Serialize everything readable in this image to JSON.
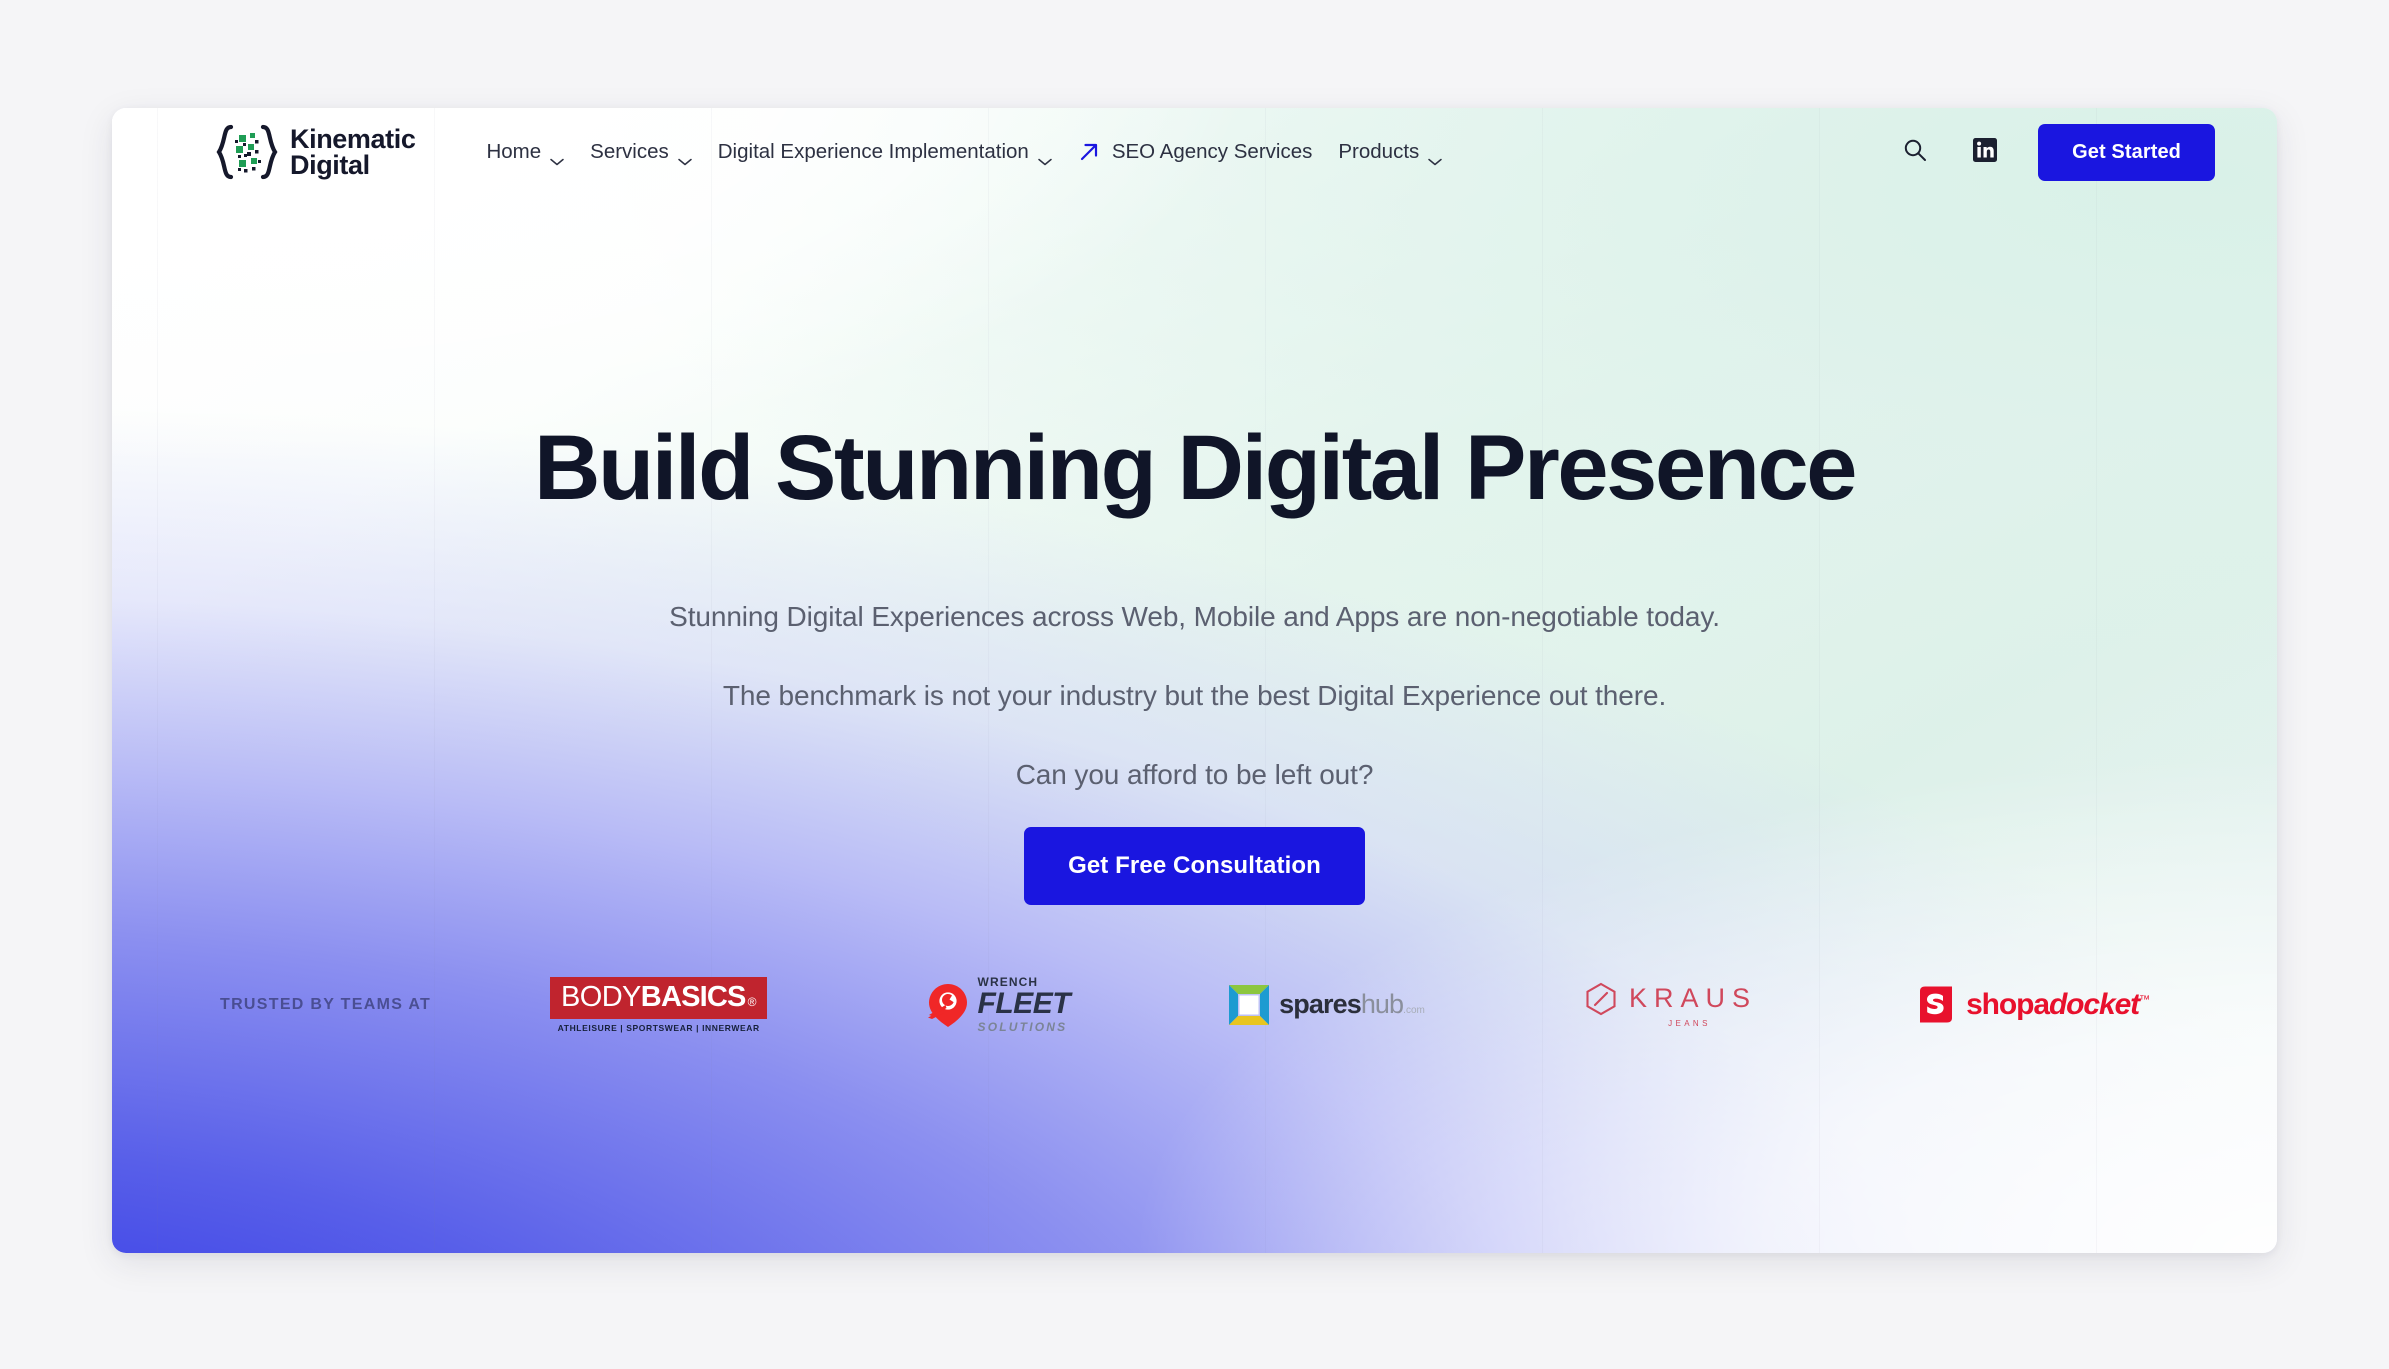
{
  "brand": {
    "name_line1": "Kinematic",
    "name_line2": "Digital",
    "logo_icon": "curly-brace-pixel-logo"
  },
  "nav": {
    "items": [
      {
        "label": "Home",
        "has_dropdown": true
      },
      {
        "label": "Services",
        "has_dropdown": true
      },
      {
        "label": "Digital Experience Implementation",
        "has_dropdown": true
      }
    ],
    "external": {
      "label": "SEO Agency Services",
      "icon": "arrow-up-right-icon"
    },
    "products": {
      "label": "Products",
      "has_dropdown": true
    }
  },
  "header": {
    "search_icon": "search-icon",
    "linkedin_icon": "linkedin-icon",
    "cta_label": "Get Started"
  },
  "hero": {
    "title": "Build Stunning Digital Presence",
    "sub1": "Stunning Digital Experiences across Web, Mobile and Apps are non-negotiable today.",
    "sub2": "The benchmark is not your industry but the best Digital Experience out there.",
    "sub3": "Can you afford to be left out?",
    "cta_label": "Get Free Consultation"
  },
  "trusted": {
    "label": "TRUSTED BY TEAMS AT",
    "logos": [
      {
        "name": "bodybasics",
        "word_a": "BODY",
        "word_b": "BASICS",
        "registered": "®",
        "tagline": "ATHLEISURE | SPORTSWEAR | INNERWEAR"
      },
      {
        "name": "wrench-fleet-solutions",
        "line1": "WRENCH",
        "line2": "FLEET",
        "line3": "SOLUTIONS"
      },
      {
        "name": "spareshub",
        "word_a": "spares",
        "word_b": "hub",
        "suffix": ".com"
      },
      {
        "name": "kraus-jeans",
        "word": "KRAUS",
        "sub": "JEANS"
      },
      {
        "name": "shopadocket",
        "word_a": "shopa",
        "word_b": "docket",
        "trademark": "™"
      }
    ]
  },
  "colors": {
    "accent_blue": "#1a16e0",
    "gradient_blue": "#3a40e6",
    "gradient_mint": "#ddf1e9",
    "heading": "#101528",
    "body_text": "#5b6070"
  }
}
